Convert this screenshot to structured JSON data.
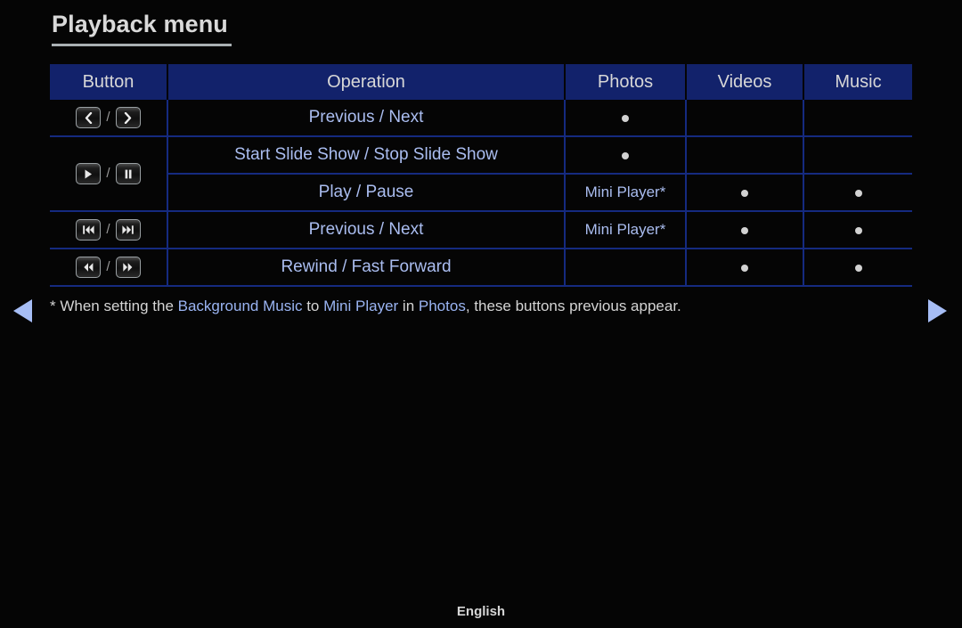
{
  "page": {
    "title": "Playback menu",
    "language_label": "English",
    "background_color": "#050505",
    "accent_blue": "#aabdf0",
    "header_blue": "#12226b",
    "border_blue": "#152a80"
  },
  "table": {
    "columns": [
      {
        "key": "button",
        "label": "Button"
      },
      {
        "key": "operation",
        "label": "Operation"
      },
      {
        "key": "photos",
        "label": "Photos"
      },
      {
        "key": "videos",
        "label": "Videos"
      },
      {
        "key": "music",
        "label": "Music"
      }
    ],
    "rows": [
      {
        "buttons": [
          "prev-chevron-icon",
          "next-chevron-icon"
        ],
        "separator": "/",
        "operation": "Previous / Next",
        "photos": "dot",
        "videos": "",
        "music": ""
      },
      {
        "buttons": [
          "play-icon",
          "pause-icon"
        ],
        "separator": "/",
        "operation": "Start Slide Show / Stop Slide Show",
        "photos": "dot",
        "videos": "",
        "music": ""
      },
      {
        "buttons": [],
        "separator": "",
        "operation": "Play / Pause",
        "photos": "Mini Player*",
        "videos": "dot",
        "music": "dot"
      },
      {
        "buttons": [
          "skip-backward-icon",
          "skip-forward-icon"
        ],
        "separator": "/",
        "operation": "Previous / Next",
        "photos": "Mini Player*",
        "videos": "dot",
        "music": "dot"
      },
      {
        "buttons": [
          "rewind-icon",
          "fast-forward-icon"
        ],
        "separator": "/",
        "operation": "Rewind / Fast Forward",
        "photos": "",
        "videos": "dot",
        "music": "dot"
      }
    ]
  },
  "footnote": {
    "prefix": "* When setting the ",
    "highlight1": "Background Music",
    "mid1": " to ",
    "highlight2": "Mini Player",
    "mid2": " in ",
    "highlight3": "Photos",
    "suffix": ", these buttons previous appear."
  },
  "navigation": {
    "prev_label": "prev-page-arrow",
    "next_label": "next-page-arrow"
  }
}
